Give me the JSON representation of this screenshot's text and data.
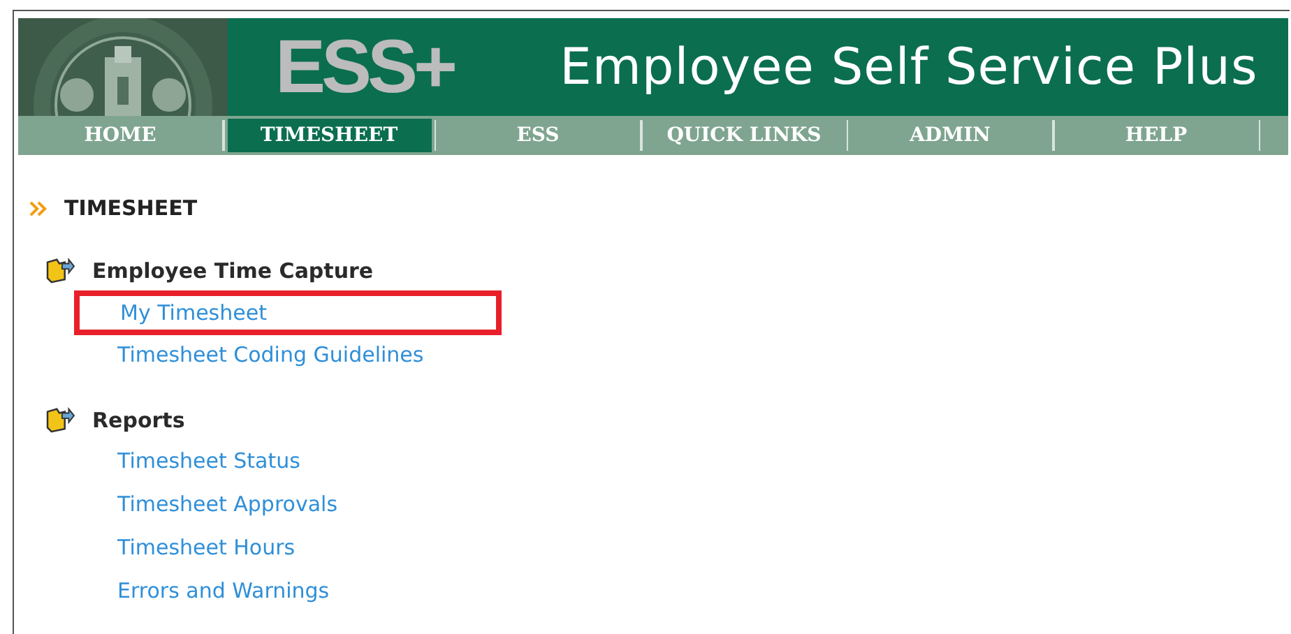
{
  "header": {
    "logo": "ESS+",
    "title": "Employee Self Service Plus"
  },
  "nav": [
    {
      "label": "HOME",
      "selected": false
    },
    {
      "label": "TIMESHEET",
      "selected": true
    },
    {
      "label": "ESS",
      "selected": false
    },
    {
      "label": "QUICK LINKS",
      "selected": false
    },
    {
      "label": "ADMIN",
      "selected": false
    },
    {
      "label": "HELP",
      "selected": false
    }
  ],
  "page_heading": "TIMESHEET",
  "sections": [
    {
      "title": "Employee Time Capture",
      "links": [
        {
          "label": "My Timesheet",
          "highlighted": true
        },
        {
          "label": "Timesheet Coding Guidelines",
          "highlighted": false
        }
      ]
    },
    {
      "title": "Reports",
      "links": [
        {
          "label": "Timesheet Status",
          "highlighted": false
        },
        {
          "label": "Timesheet Approvals",
          "highlighted": false
        },
        {
          "label": "Timesheet Hours",
          "highlighted": false
        },
        {
          "label": "Errors and Warnings",
          "highlighted": false
        }
      ]
    }
  ]
}
